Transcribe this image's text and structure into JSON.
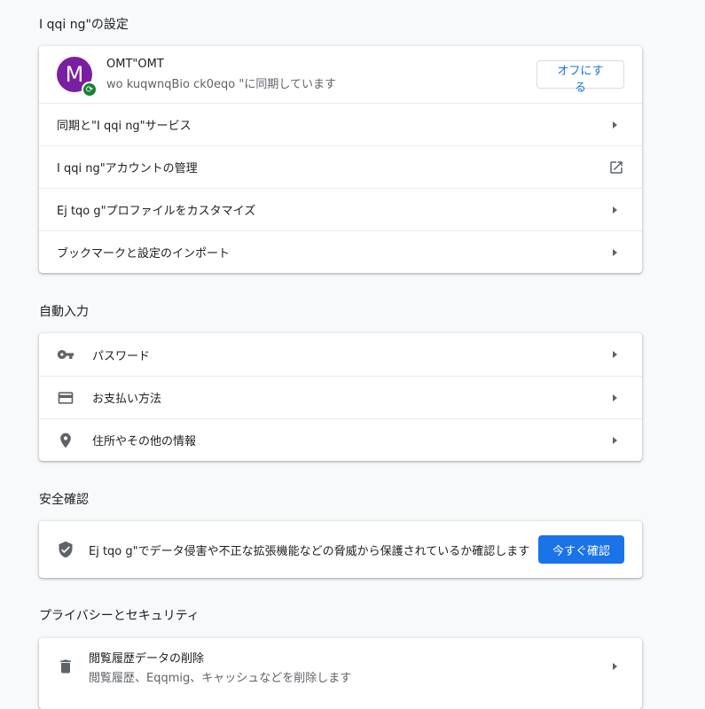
{
  "google": {
    "title": "I qqi ng\"の設定",
    "profile": {
      "initial": "M",
      "name": "OMT\"OMT",
      "sync": "wo kuqwnqBio ck0eqo \"に同期しています",
      "off_button": "オフにする"
    },
    "rows": [
      "同期と\"I qqi ng\"サービス",
      "I qqi ng\"アカウントの管理",
      "Ej tqo g\"プロファイルをカスタマイズ",
      "ブックマークと設定のインポート"
    ]
  },
  "autofill": {
    "title": "自動入力",
    "rows": [
      "パスワード",
      "お支払い方法",
      "住所やその他の情報"
    ]
  },
  "safety": {
    "title": "安全確認",
    "text": "Ej tqo g\"でデータ侵害や不正な拡張機能などの脅威から保護されているか確認します",
    "button": "今すぐ確認"
  },
  "privacy": {
    "title": "プライバシーとセキュリティ",
    "rows": [
      {
        "label": "閲覧履歴データの削除",
        "sub": "閲覧履歴、Eqqmig、キャッシュなどを削除します"
      }
    ]
  },
  "colors": {
    "accent": "#1a73e8",
    "avatar": "#7b1fa2",
    "sync_badge": "#188038"
  }
}
